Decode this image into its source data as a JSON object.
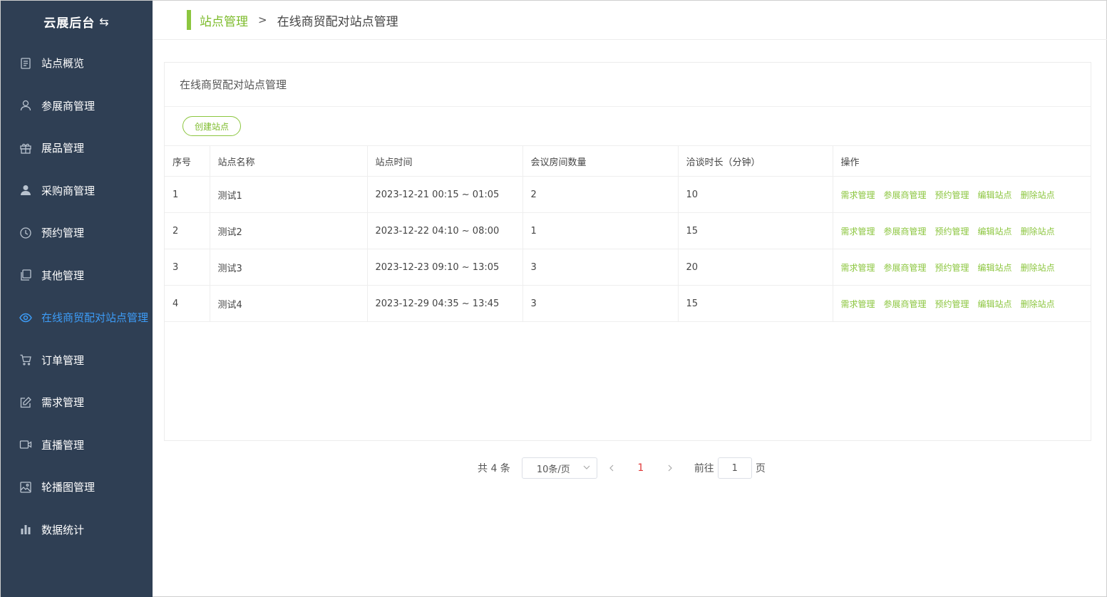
{
  "brand": {
    "title": "云展后台"
  },
  "menu": [
    {
      "label": "站点概览",
      "icon": "document-icon"
    },
    {
      "label": "参展商管理",
      "icon": "user-icon"
    },
    {
      "label": "展品管理",
      "icon": "gift-icon"
    },
    {
      "label": "采购商管理",
      "icon": "user-filled-icon"
    },
    {
      "label": "预约管理",
      "icon": "clock-icon"
    },
    {
      "label": "其他管理",
      "icon": "copy-icon"
    },
    {
      "label": "在线商贸配对站点管理",
      "icon": "eye-icon",
      "active": true
    },
    {
      "label": "订单管理",
      "icon": "cart-icon"
    },
    {
      "label": "需求管理",
      "icon": "edit-icon"
    },
    {
      "label": "直播管理",
      "icon": "video-icon"
    },
    {
      "label": "轮播图管理",
      "icon": "picture-icon"
    },
    {
      "label": "数据统计",
      "icon": "bar-chart-icon"
    }
  ],
  "breadcrumb": {
    "parent": "站点管理",
    "separator": ">",
    "current": "在线商贸配对站点管理"
  },
  "card": {
    "title": "在线商贸配对站点管理",
    "create_label": "创建站点"
  },
  "table": {
    "headers": [
      "序号",
      "站点名称",
      "站点时间",
      "会议房间数量",
      "洽谈时长（分钟）",
      "操作"
    ],
    "actions": [
      "需求管理",
      "参展商管理",
      "预约管理",
      "编辑站点",
      "删除站点"
    ],
    "rows": [
      {
        "no": "1",
        "name": "测试1",
        "time": "2023-12-21 00:15 ~ 01:05",
        "rooms": "2",
        "duration": "10"
      },
      {
        "no": "2",
        "name": "测试2",
        "time": "2023-12-22 04:10 ~ 08:00",
        "rooms": "1",
        "duration": "15"
      },
      {
        "no": "3",
        "name": "测试3",
        "time": "2023-12-23 09:10 ~ 13:05",
        "rooms": "3",
        "duration": "20"
      },
      {
        "no": "4",
        "name": "测试4",
        "time": "2023-12-29 04:35 ~ 13:45",
        "rooms": "3",
        "duration": "15"
      }
    ]
  },
  "pagination": {
    "total": "共 4 条",
    "page_size": "10条/页",
    "current_page": "1",
    "goto_label": "前往",
    "goto_value": "1",
    "goto_unit": "页"
  },
  "colors": {
    "sidebar_bg": "#2f3f54",
    "accent_green": "#8cc63f",
    "active_blue": "#3d9cf7",
    "page_red": "#e03a3a"
  }
}
